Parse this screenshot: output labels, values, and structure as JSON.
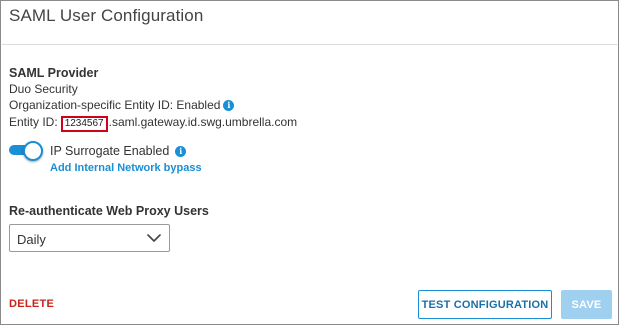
{
  "colors": {
    "accent": "#1a8fd5",
    "danger": "#c9231b",
    "highlight_border": "#d0021b",
    "disabled_button": "#9fd0ef"
  },
  "header": {
    "title": "SAML User Configuration"
  },
  "provider": {
    "section_label": "SAML Provider",
    "name": "Duo Security",
    "org_entity_label": "Organization-specific Entity ID: Enabled",
    "org_entity_info_icon": "info-icon",
    "entity_id_label": "Entity ID:",
    "entity_id_highlighted": "1234567",
    "entity_id_suffix": ".saml.gateway.id.swg.umbrella.com"
  },
  "ip_surrogate": {
    "toggle_state": "on",
    "label": "IP Surrogate Enabled",
    "info_icon": "info-icon",
    "link_label": "Add Internal Network bypass"
  },
  "reauth": {
    "section_label": "Re-authenticate Web Proxy Users",
    "selected": "Daily",
    "chevron_icon": "chevron-down-icon"
  },
  "footer": {
    "delete_label": "DELETE",
    "test_label": "TEST CONFIGURATION",
    "save_label": "SAVE",
    "save_disabled": true
  }
}
